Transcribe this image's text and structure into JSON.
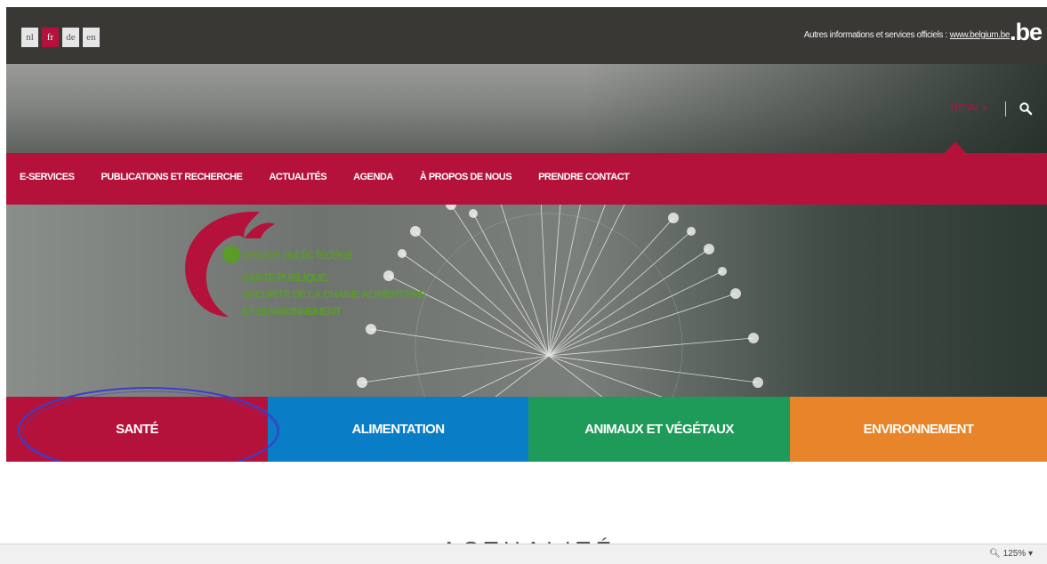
{
  "languages": [
    {
      "code": "nl",
      "active": false
    },
    {
      "code": "fr",
      "active": true
    },
    {
      "code": "de",
      "active": false
    },
    {
      "code": "en",
      "active": false
    }
  ],
  "gov_bar": {
    "text": "Autres informations et services officiels :",
    "link": "www.belgium.be",
    "logo": ".be"
  },
  "header": {
    "menu_label": "MENU ∨",
    "search_icon": "search-icon"
  },
  "nav": {
    "items": [
      "E-SERVICES",
      "PUBLICATIONS ET RECHERCHE",
      "ACTUALITÉS",
      "AGENDA",
      "À PROPOS DE NOUS",
      "PRENDRE CONTACT"
    ]
  },
  "logo": {
    "line1": "service public fédéral",
    "line2": "SANTE PUBLIQUE,",
    "line3": "SECURITE DE LA CHAINE ALIMENTAIRE",
    "line4": "ET ENVIRONNEMENT"
  },
  "categories": [
    {
      "label": "SANTÉ",
      "color": "#b5123b"
    },
    {
      "label": "ALIMENTATION",
      "color": "#0a7dc7"
    },
    {
      "label": "ANIMAUX ET VÉGÉTAUX",
      "color": "#1e9b58"
    },
    {
      "label": "ENVIRONNEMENT",
      "color": "#e8852a"
    }
  ],
  "section_title": "ACTUALITÉ",
  "statusbar": {
    "zoom": "125%"
  },
  "colors": {
    "brand_red": "#b5123b",
    "annotation": "#3b3fc9"
  }
}
